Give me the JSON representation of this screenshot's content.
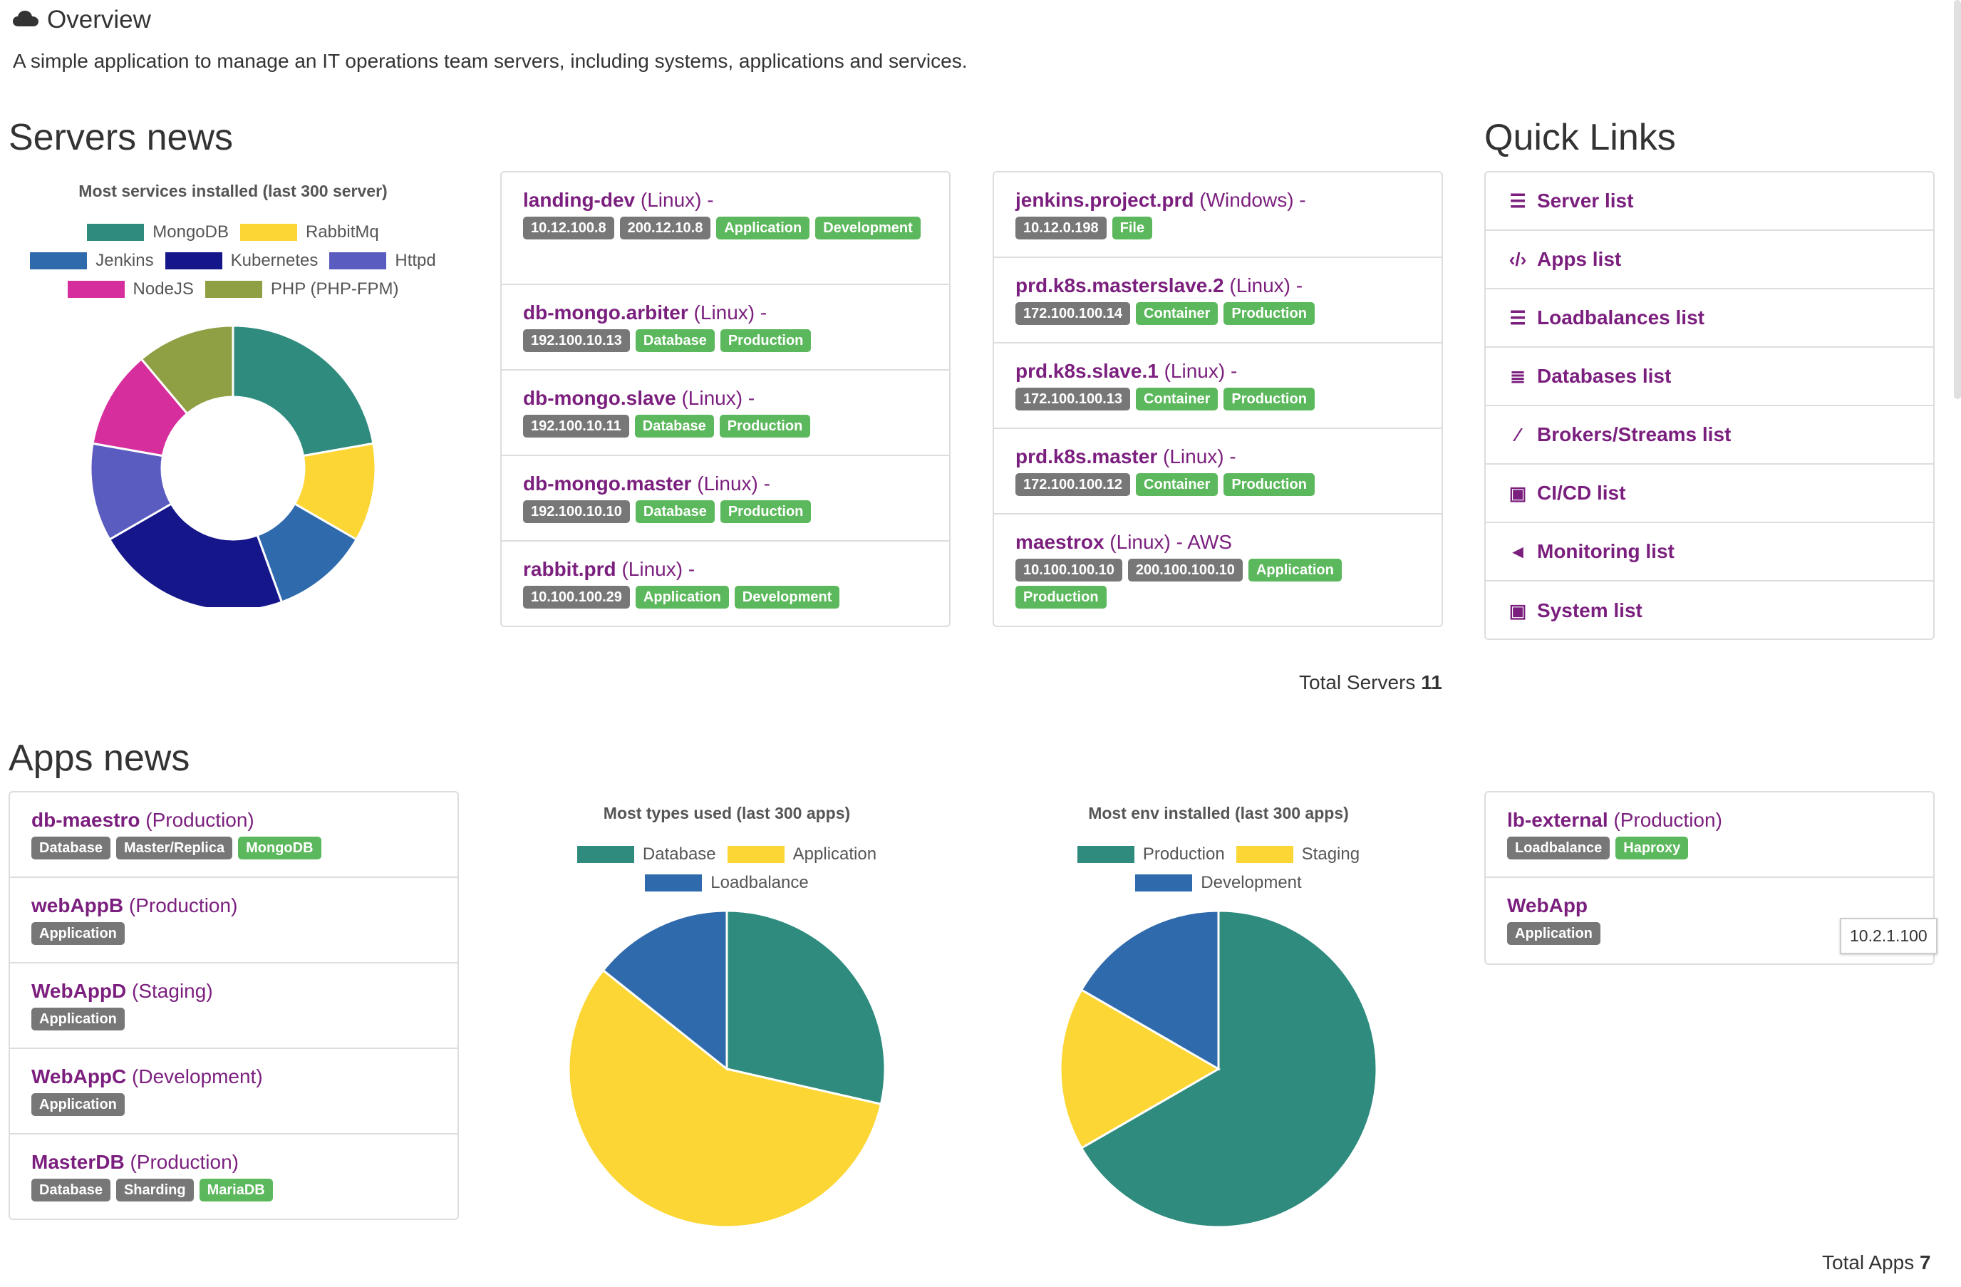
{
  "header": {
    "title": "Overview",
    "icon": "cloud-icon",
    "description": "A simple application to manage an IT operations team servers, including systems, applications and services."
  },
  "servers_news": {
    "title": "Servers news",
    "chart": {
      "title": "Most services installed (last 300 server)"
    },
    "column1": [
      {
        "name": "landing-dev",
        "meta": "(Linux) -",
        "tags": [
          {
            "text": "10.12.100.8",
            "color": "gray"
          },
          {
            "text": "200.12.10.8",
            "color": "gray"
          },
          {
            "text": "Application",
            "color": "green"
          },
          {
            "text": "Development",
            "color": "green"
          }
        ]
      },
      {
        "name": "db-mongo.arbiter",
        "meta": "(Linux) -",
        "tags": [
          {
            "text": "192.100.10.13",
            "color": "gray"
          },
          {
            "text": "Database",
            "color": "green"
          },
          {
            "text": "Production",
            "color": "green"
          }
        ]
      },
      {
        "name": "db-mongo.slave",
        "meta": "(Linux) -",
        "tags": [
          {
            "text": "192.100.10.11",
            "color": "gray"
          },
          {
            "text": "Database",
            "color": "green"
          },
          {
            "text": "Production",
            "color": "green"
          }
        ]
      },
      {
        "name": "db-mongo.master",
        "meta": "(Linux) -",
        "tags": [
          {
            "text": "192.100.10.10",
            "color": "gray"
          },
          {
            "text": "Database",
            "color": "green"
          },
          {
            "text": "Production",
            "color": "green"
          }
        ]
      },
      {
        "name": "rabbit.prd",
        "meta": "(Linux) -",
        "tags": [
          {
            "text": "10.100.100.29",
            "color": "gray"
          },
          {
            "text": "Application",
            "color": "green"
          },
          {
            "text": "Development",
            "color": "green"
          }
        ]
      }
    ],
    "column2": [
      {
        "name": "jenkins.project.prd",
        "meta": "(Windows) -",
        "tags": [
          {
            "text": "10.12.0.198",
            "color": "gray"
          },
          {
            "text": "File",
            "color": "green"
          }
        ]
      },
      {
        "name": "prd.k8s.masterslave.2",
        "meta": "(Linux) -",
        "tags": [
          {
            "text": "172.100.100.14",
            "color": "gray"
          },
          {
            "text": "Container",
            "color": "green"
          },
          {
            "text": "Production",
            "color": "green"
          }
        ]
      },
      {
        "name": "prd.k8s.slave.1",
        "meta": "(Linux) -",
        "tags": [
          {
            "text": "172.100.100.13",
            "color": "gray"
          },
          {
            "text": "Container",
            "color": "green"
          },
          {
            "text": "Production",
            "color": "green"
          }
        ]
      },
      {
        "name": "prd.k8s.master",
        "meta": "(Linux) -",
        "tags": [
          {
            "text": "172.100.100.12",
            "color": "gray"
          },
          {
            "text": "Container",
            "color": "green"
          },
          {
            "text": "Production",
            "color": "green"
          }
        ]
      },
      {
        "name": "maestrox",
        "meta": "(Linux) - AWS",
        "tags": [
          {
            "text": "10.100.100.10",
            "color": "gray"
          },
          {
            "text": "200.100.100.10",
            "color": "gray"
          },
          {
            "text": "Application",
            "color": "green"
          },
          {
            "text": "Production",
            "color": "green"
          }
        ]
      }
    ],
    "total_label": "Total Servers",
    "total_value": "11"
  },
  "quick_links": {
    "title": "Quick Links",
    "items": [
      {
        "label": "Server list",
        "icon": "server-icon"
      },
      {
        "label": "Apps list",
        "icon": "code-icon"
      },
      {
        "label": "Loadbalances list",
        "icon": "tasks-icon"
      },
      {
        "label": "Databases list",
        "icon": "database-icon"
      },
      {
        "label": "Brokers/Streams list",
        "icon": "magic-wand-icon"
      },
      {
        "label": "CI/CD list",
        "icon": "briefcase-icon"
      },
      {
        "label": "Monitoring list",
        "icon": "bullhorn-icon"
      },
      {
        "label": "System list",
        "icon": "briefcase-icon"
      }
    ]
  },
  "apps_news": {
    "title": "Apps news",
    "list1": [
      {
        "name": "db-maestro",
        "meta": "(Production)",
        "tags": [
          {
            "text": "Database",
            "color": "gray"
          },
          {
            "text": "Master/Replica",
            "color": "gray"
          },
          {
            "text": "MongoDB",
            "color": "green"
          }
        ]
      },
      {
        "name": "webAppB",
        "meta": "(Production)",
        "tags": [
          {
            "text": "Application",
            "color": "gray"
          }
        ]
      },
      {
        "name": "WebAppD",
        "meta": "(Staging)",
        "tags": [
          {
            "text": "Application",
            "color": "gray"
          }
        ]
      },
      {
        "name": "WebAppC",
        "meta": "(Development)",
        "tags": [
          {
            "text": "Application",
            "color": "gray"
          }
        ]
      },
      {
        "name": "MasterDB",
        "meta": "(Production)",
        "tags": [
          {
            "text": "Database",
            "color": "gray"
          },
          {
            "text": "Sharding",
            "color": "gray"
          },
          {
            "text": "MariaDB",
            "color": "green"
          }
        ]
      }
    ],
    "list2": [
      {
        "name": "lb-external",
        "meta": "(Production)",
        "tags": [
          {
            "text": "Loadbalance",
            "color": "gray"
          },
          {
            "text": "Haproxy",
            "color": "green"
          }
        ]
      },
      {
        "name": "WebApp",
        "meta": "",
        "tags": [
          {
            "text": "Application",
            "color": "gray"
          }
        ]
      }
    ],
    "tooltip": "10.2.1.100",
    "total_label": "Total Apps",
    "total_value": "7"
  },
  "chart_data": [
    {
      "type": "pie",
      "variant": "doughnut",
      "title": "Most services installed (last 300 server)",
      "legend_position": "top",
      "categories": [
        "MongoDB",
        "RabbitMq",
        "Jenkins",
        "Kubernetes",
        "Httpd",
        "NodeJS",
        "PHP (PHP-FPM)"
      ],
      "values": [
        2,
        1,
        1,
        2,
        1,
        1,
        1
      ],
      "colors": [
        "#2e8b7e",
        "#fcd634",
        "#2f6aad",
        "#14168a",
        "#5b5cc0",
        "#d62e9c",
        "#8ea043"
      ]
    },
    {
      "type": "pie",
      "title": "Most types used (last 300 apps)",
      "legend_position": "top",
      "categories": [
        "Database",
        "Application",
        "Loadbalance"
      ],
      "values": [
        2,
        4,
        1
      ],
      "colors": [
        "#2e8b7e",
        "#fcd634",
        "#2f6aad"
      ]
    },
    {
      "type": "pie",
      "title": "Most env installed (last 300 apps)",
      "legend_position": "top",
      "categories": [
        "Production",
        "Staging",
        "Development"
      ],
      "values": [
        4,
        1,
        1
      ],
      "colors": [
        "#2e8b7e",
        "#fcd634",
        "#2f6aad"
      ]
    }
  ]
}
